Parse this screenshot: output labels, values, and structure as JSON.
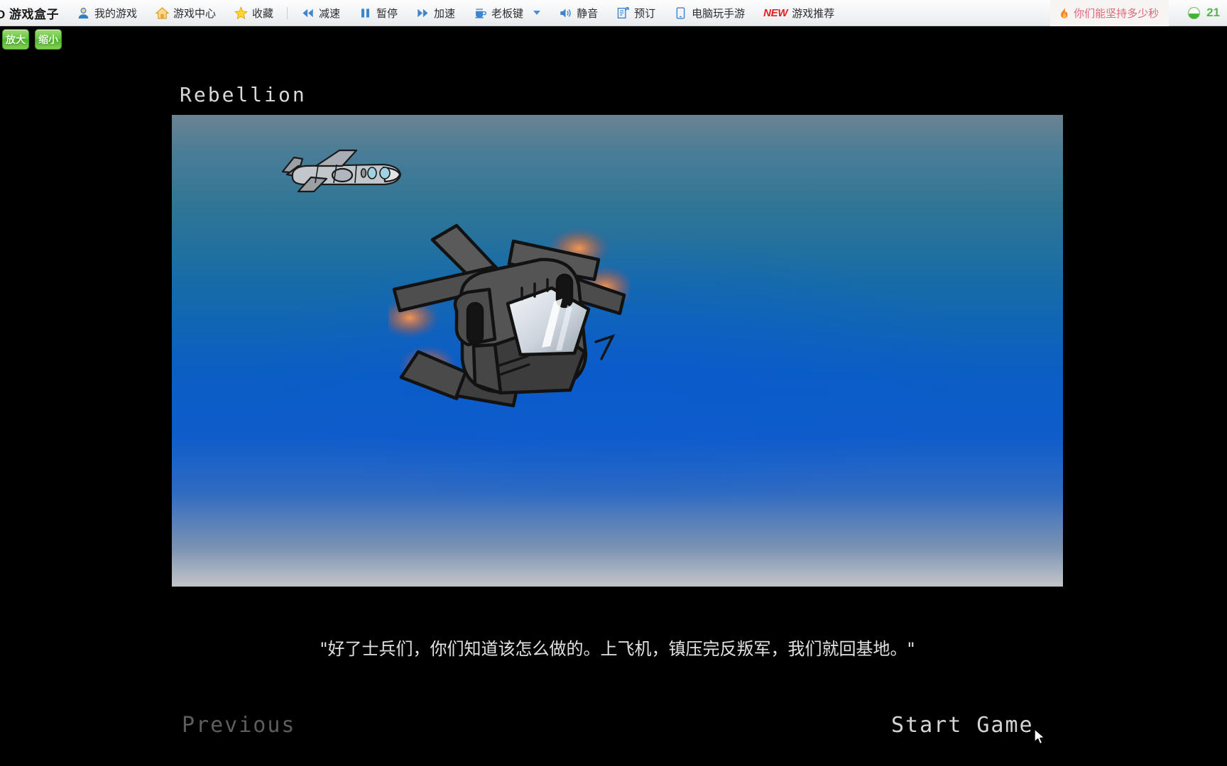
{
  "toolbar": {
    "logo": "O 游戏盒子",
    "items": [
      {
        "label": "我的游戏",
        "icon": "user-icon"
      },
      {
        "label": "游戏中心",
        "icon": "home-icon"
      },
      {
        "label": "收藏",
        "icon": "star-icon"
      },
      {
        "label": "减速",
        "icon": "rewind-icon"
      },
      {
        "label": "暂停",
        "icon": "pause-icon"
      },
      {
        "label": "加速",
        "icon": "fastforward-icon"
      },
      {
        "label": "老板键",
        "icon": "coffee-cup-icon"
      },
      {
        "label": "静音",
        "icon": "speaker-icon"
      },
      {
        "label": "预订",
        "icon": "booking-icon"
      },
      {
        "label": "电脑玩手游",
        "icon": "phone-icon"
      },
      {
        "label": "游戏推荐",
        "icon": "new-badge"
      }
    ],
    "new_badge": "NEW",
    "promo": "你们能坚持多少秒",
    "promo_icon": "flame-icon",
    "status_icon": "green-gauge-icon",
    "status_count": "21"
  },
  "zoom_controls": {
    "zoom_in": "放大",
    "zoom_out": "缩小"
  },
  "game": {
    "title": "Rebellion",
    "dialogue": "\"好了士兵们，你们知道该怎么做的。上飞机，镇压完反叛军，我们就回基地。\"",
    "previous_label": "Previous",
    "start_label": "Start Game"
  },
  "colors": {
    "accent_blue": "#4a8fd4",
    "promo_pink": "#e0637a",
    "status_green": "#56b84a",
    "button_green": "#63c83c",
    "sky_top": "#6b8391",
    "sky_mid": "#0a5ec4",
    "sky_bottom": "#c3c6c9",
    "hull_dark": "#4a4a4a",
    "canopy_light": "#e9edf2",
    "engine_glow": "#d97a3a"
  }
}
